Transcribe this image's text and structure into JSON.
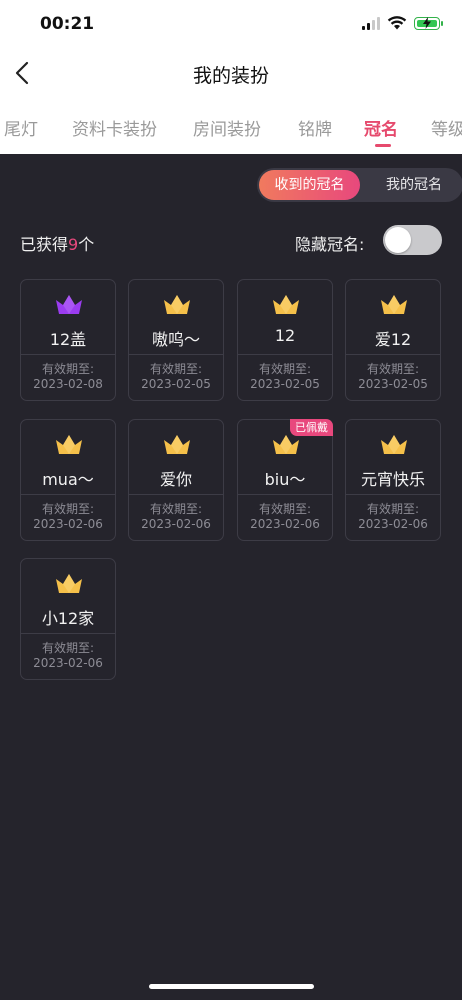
{
  "status_bar": {
    "time": "00:21"
  },
  "header": {
    "title": "我的装扮"
  },
  "tabs": [
    {
      "label": "尾灯"
    },
    {
      "label": "资料卡装扮"
    },
    {
      "label": "房间装扮"
    },
    {
      "label": "铭牌"
    },
    {
      "label": "冠名"
    },
    {
      "label": "等级"
    }
  ],
  "active_tab": "冠名",
  "segment": {
    "received": "收到的冠名",
    "mine": "我的冠名"
  },
  "summary": {
    "prefix": "已获得",
    "count": "9",
    "suffix": "个"
  },
  "hide_toggle": {
    "label": "隐藏冠名:",
    "on": false
  },
  "colors": {
    "accent": "#e8487d",
    "background": "#25242c",
    "crown_gold": "#f5c04a",
    "crown_purple": "#9b3cf0"
  },
  "cards": [
    {
      "name": "12盖",
      "valid_label": "有效期至:",
      "date": "2023-02-08",
      "crown": "purple-crown-icon"
    },
    {
      "name": "嗷呜～",
      "valid_label": "有效期至:",
      "date": "2023-02-05",
      "crown": "gold-crown-icon"
    },
    {
      "name": "12",
      "valid_label": "有效期至:",
      "date": "2023-02-05",
      "crown": "gold-crown-icon"
    },
    {
      "name": "爱12",
      "valid_label": "有效期至:",
      "date": "2023-02-05",
      "crown": "gold-crown-icon"
    },
    {
      "name": "mua～",
      "valid_label": "有效期至:",
      "date": "2023-02-06",
      "crown": "gold-crown-icon"
    },
    {
      "name": "爱你",
      "valid_label": "有效期至:",
      "date": "2023-02-06",
      "crown": "gold-crown-icon"
    },
    {
      "name": "biu～",
      "valid_label": "有效期至:",
      "date": "2023-02-06",
      "crown": "gold-crown-icon",
      "badge": "已佩戴"
    },
    {
      "name": "元宵快乐",
      "valid_label": "有效期至:",
      "date": "2023-02-06",
      "crown": "gold-crown-icon"
    },
    {
      "name": "小12家",
      "valid_label": "有效期至:",
      "date": "2023-02-06",
      "crown": "gold-crown-icon"
    }
  ]
}
